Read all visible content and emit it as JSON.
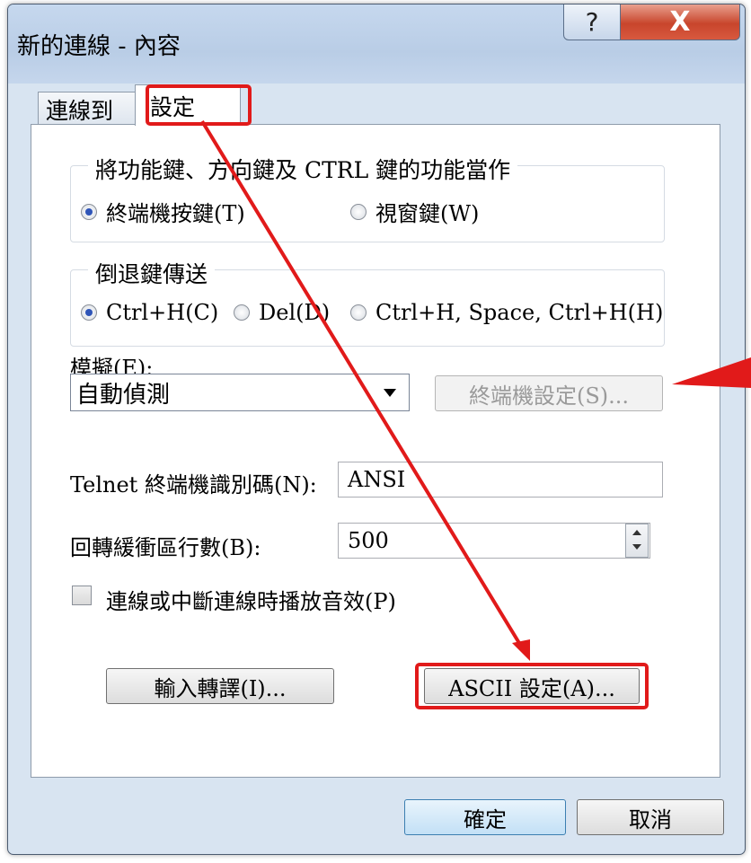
{
  "window": {
    "title": "新的連線 - 內容",
    "help_label": "?",
    "close_label": "X"
  },
  "tabs": [
    {
      "label": "連線到",
      "selected": false
    },
    {
      "label": "設定",
      "selected": true
    }
  ],
  "keys_group": {
    "legend": "將功能鍵、方向鍵及 CTRL 鍵的功能當作",
    "options": [
      {
        "label": "終端機按鍵(T)",
        "selected": true
      },
      {
        "label": "視窗鍵(W)",
        "selected": false
      }
    ]
  },
  "backspace_group": {
    "legend": "倒退鍵傳送",
    "options": [
      {
        "label": "Ctrl+H(C)",
        "selected": true
      },
      {
        "label": "Del(D)",
        "selected": false
      },
      {
        "label": "Ctrl+H, Space, Ctrl+H(H)",
        "selected": false
      }
    ]
  },
  "emulation": {
    "label": "模擬(E):",
    "value": "自動偵測",
    "terminal_settings_label": "終端機設定(S)..."
  },
  "telnet_id": {
    "label": "Telnet 終端機識別碼(N):",
    "value": "ANSI"
  },
  "backscroll": {
    "label": "回轉緩衝區行數(B):",
    "value": "500"
  },
  "sound": {
    "label": "連線或中斷連線時播放音效(P)",
    "checked": false
  },
  "buttons": {
    "input_translation": "輸入轉譯(I)...",
    "ascii_settings": "ASCII 設定(A)...",
    "ok": "確定",
    "cancel": "取消"
  },
  "colors": {
    "highlight": "#e11a1a",
    "radio_dot": "#2f55b8"
  }
}
